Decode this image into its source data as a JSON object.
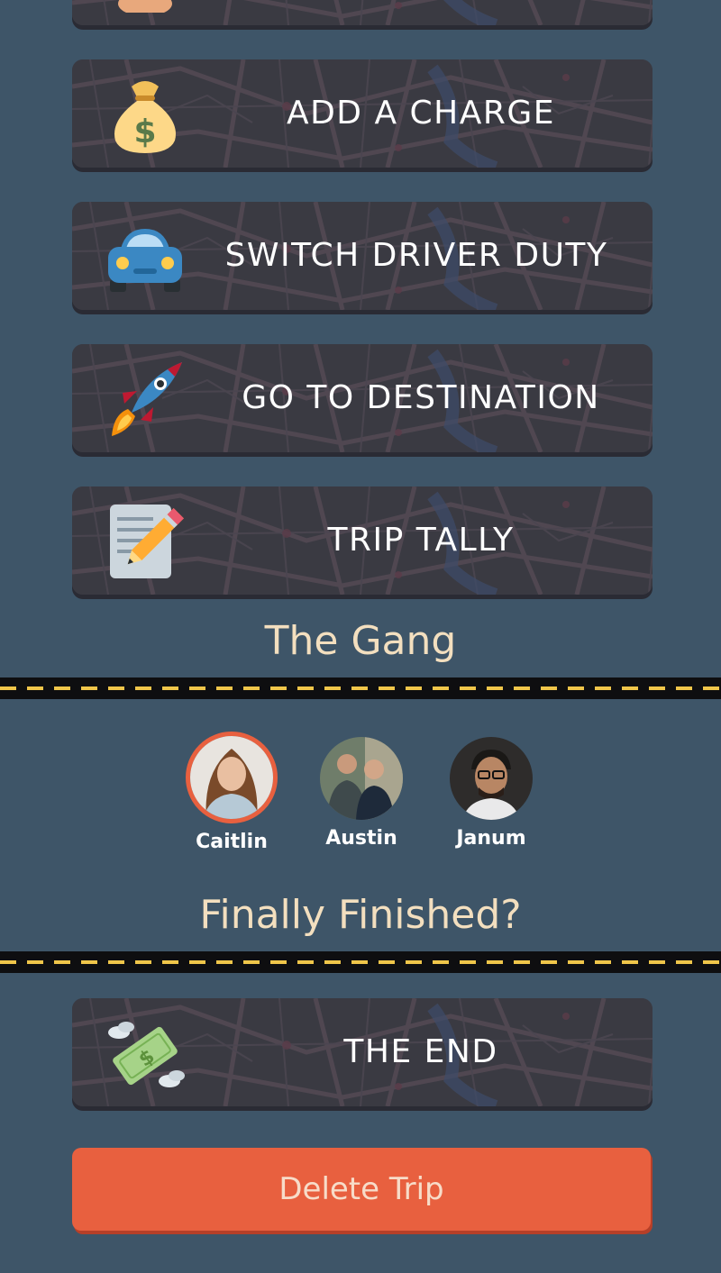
{
  "actions": [
    {
      "label": "ADD A CHARGE",
      "icon": "money-bag-icon"
    },
    {
      "label": "SWITCH DRIVER DUTY",
      "icon": "car-icon"
    },
    {
      "label": "GO TO DESTINATION",
      "icon": "rocket-icon"
    },
    {
      "label": "TRIP TALLY",
      "icon": "memo-icon"
    }
  ],
  "gang": {
    "title": "The Gang",
    "members": [
      {
        "name": "Caitlin",
        "selected": true
      },
      {
        "name": "Austin",
        "selected": false
      },
      {
        "name": "Janum",
        "selected": false
      }
    ]
  },
  "finish": {
    "title": "Finally Finished?",
    "end_button": {
      "label": "THE END",
      "icon": "flying-money-icon"
    },
    "delete_label": "Delete Trip"
  },
  "colors": {
    "background": "#3e5568",
    "button_dark": "#3a3a42",
    "accent_orange": "#e8603f",
    "title_cream": "#f3dfbf",
    "road_dash": "#f0c64a"
  }
}
